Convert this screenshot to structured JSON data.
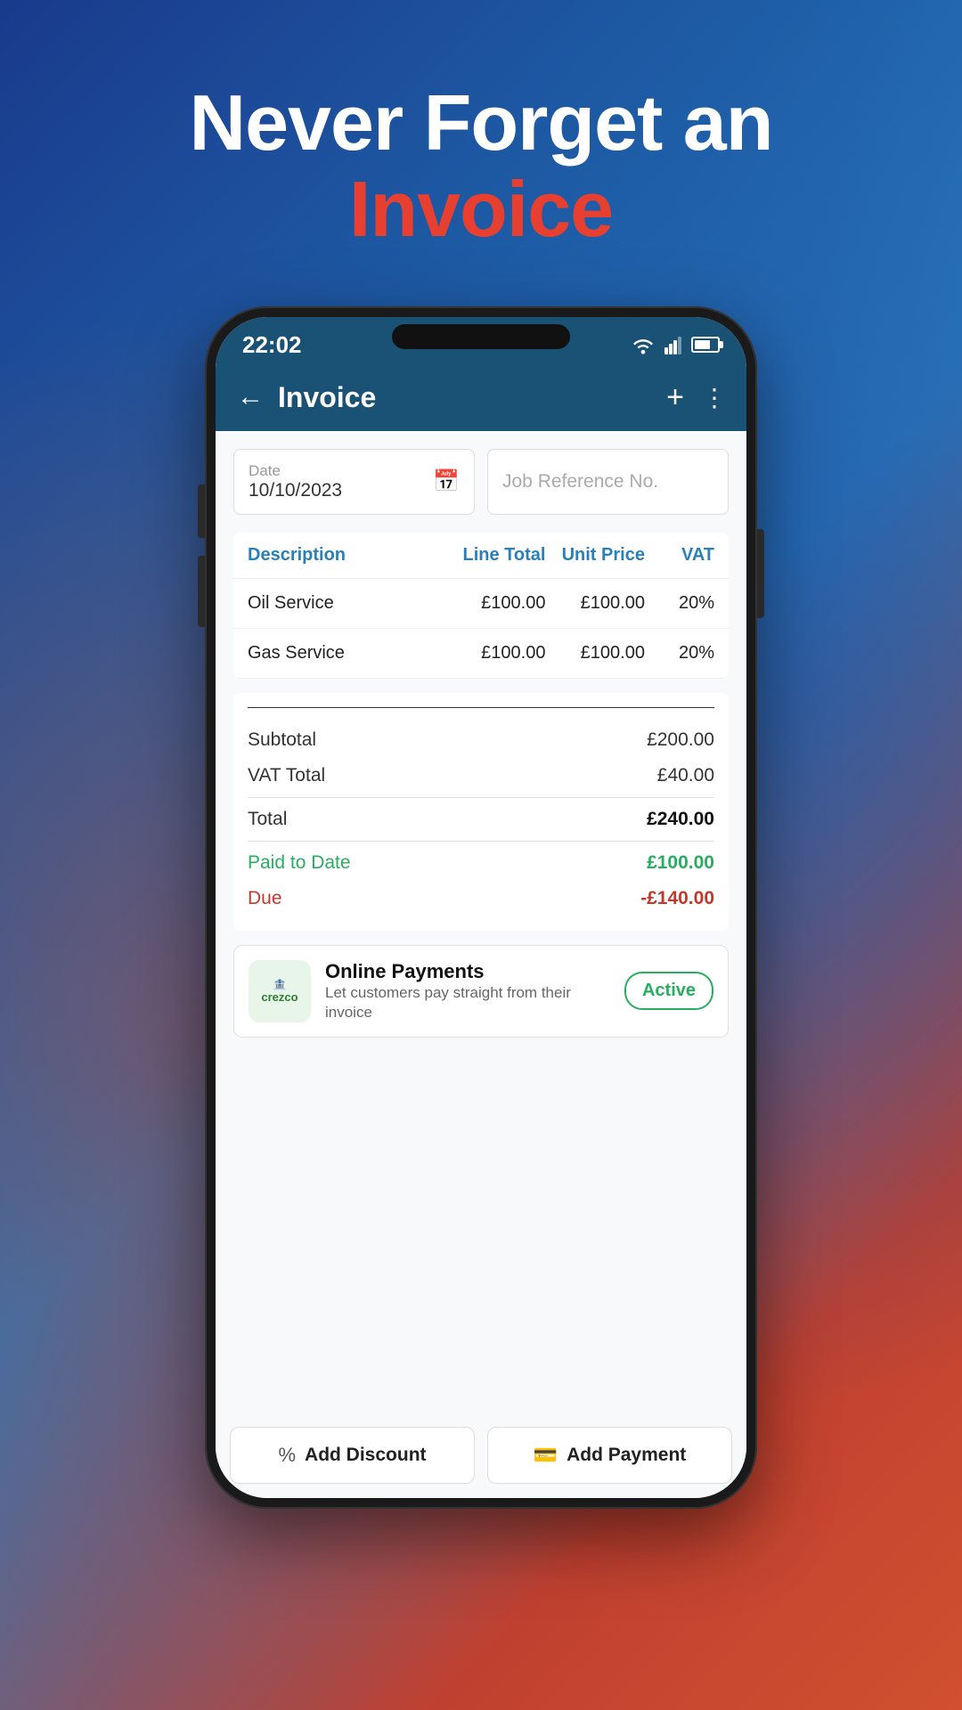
{
  "hero": {
    "line1": "Never Forget an",
    "line2": "Invoice"
  },
  "status_bar": {
    "time": "22:02"
  },
  "app_header": {
    "title": "Invoice",
    "back_label": "←",
    "plus_label": "+",
    "dots_label": "⋮"
  },
  "date_field": {
    "label": "Date",
    "value": "10/10/2023",
    "placeholder": "Job Reference No."
  },
  "table": {
    "headers": {
      "description": "Description",
      "line_total": "Line Total",
      "unit_price": "Unit Price",
      "vat": "VAT"
    },
    "rows": [
      {
        "description": "Oil Service",
        "line_total": "£100.00",
        "unit_price": "£100.00",
        "vat": "20%"
      },
      {
        "description": "Gas Service",
        "line_total": "£100.00",
        "unit_price": "£100.00",
        "vat": "20%"
      }
    ]
  },
  "totals": {
    "subtotal_label": "Subtotal",
    "subtotal_value": "£200.00",
    "vat_total_label": "VAT Total",
    "vat_total_value": "£40.00",
    "total_label": "Total",
    "total_value": "£240.00",
    "paid_label": "Paid to Date",
    "paid_value": "£100.00",
    "due_label": "Due",
    "due_value": "-£140.00"
  },
  "payments_card": {
    "logo_text": "🏦 crezco",
    "title": "Online Payments",
    "description": "Let customers pay straight from their invoice",
    "badge": "Active"
  },
  "bottom_buttons": {
    "discount_icon": "%",
    "discount_label": "Add Discount",
    "payment_icon": "💳",
    "payment_label": "Add Payment"
  }
}
